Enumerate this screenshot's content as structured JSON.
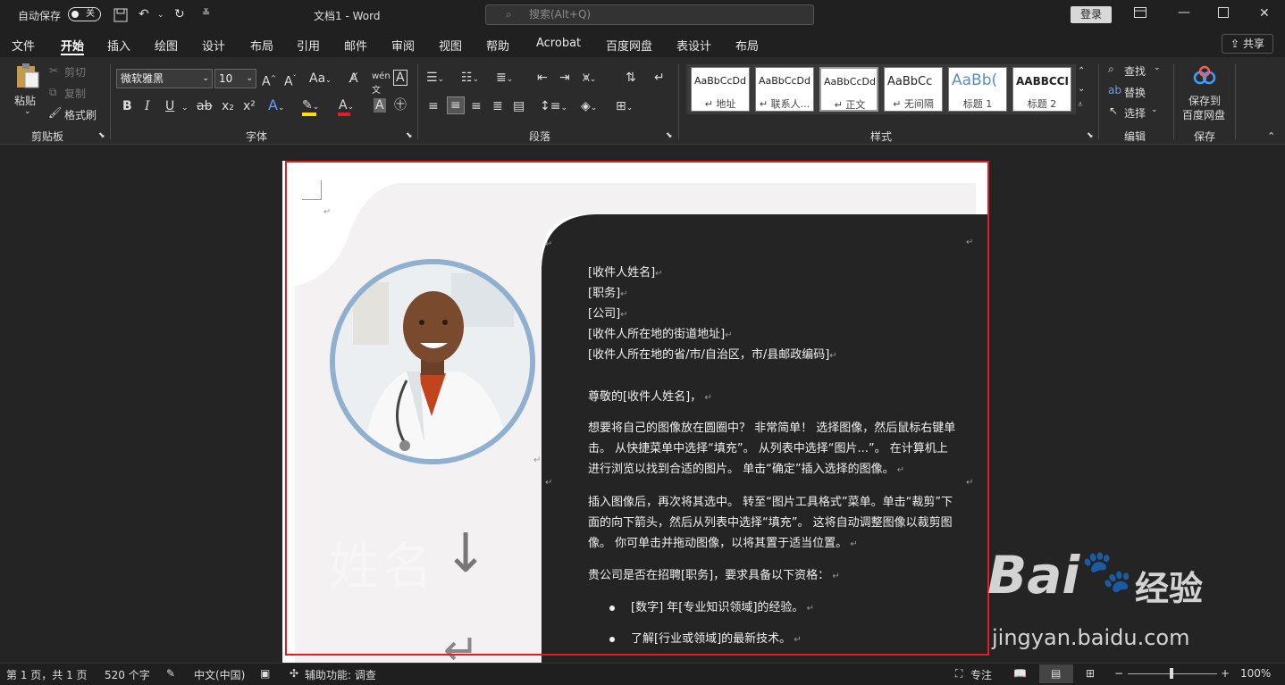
{
  "titlebar": {
    "autosave_label": "自动保存",
    "autosave_state": "关",
    "doc_title": "文档1  -  Word",
    "search_placeholder": "搜索(Alt+Q)",
    "login_label": "登录"
  },
  "menu": {
    "tabs": [
      "文件",
      "开始",
      "插入",
      "绘图",
      "设计",
      "布局",
      "引用",
      "邮件",
      "审阅",
      "视图",
      "帮助",
      "Acrobat",
      "百度网盘",
      "表设计",
      "布局"
    ],
    "active": "开始",
    "share_label": "共享"
  },
  "ribbon": {
    "clipboard": {
      "paste": "粘贴",
      "cut": "剪切",
      "copy": "复制",
      "format_painter": "格式刷",
      "group": "剪贴板"
    },
    "font": {
      "font_name": "微软雅黑",
      "font_size": "10",
      "group": "字体",
      "bold": "B",
      "italic": "I",
      "underline": "U",
      "strike": "ab",
      "sub": "x₂",
      "sup": "x²"
    },
    "paragraph": {
      "group": "段落"
    },
    "styles": {
      "group": "样式",
      "items": [
        {
          "preview": "AaBbCcDd",
          "name": "↵ 地址"
        },
        {
          "preview": "AaBbCcDd",
          "name": "↵ 联系人..."
        },
        {
          "preview": "AaBbCcDd",
          "name": "↵ 正文"
        },
        {
          "preview": "AaBbCc",
          "name": "↵ 无间隔"
        },
        {
          "preview": "AaBb(",
          "name": "标题 1"
        },
        {
          "preview": "AABBCCI",
          "name": "标题 2"
        }
      ]
    },
    "editing": {
      "find": "查找",
      "replace": "替换",
      "select": "选择",
      "group": "编辑"
    },
    "save": {
      "label1": "保存到",
      "label2": "百度网盘",
      "group": "保存"
    }
  },
  "document": {
    "address_lines": [
      "[收件人姓名]",
      "[职务]",
      "[公司]",
      "[收件人所在地的街道地址]",
      "[收件人所在地的省/市/自治区，市/县邮政编码]"
    ],
    "salutation": "尊敬的[收件人姓名]，",
    "para1": "想要将自己的图像放在圆圈中？ 非常简单！ 选择图像，然后鼠标右键单击。 从快捷菜单中选择“填充”。 从列表中选择“图片...”。 在计算机上进行浏览以找到合适的图片。 单击“确定”插入选择的图像。",
    "para2": "插入图像后，再次将其选中。 转至“图片工具格式”菜单。单击“裁剪”下面的向下箭头，然后从列表中选择“填充”。 这将自动调整图像以裁剪图像。 你可单击并拖动图像，以将其置于适当位置。",
    "para3": "贵公司是否在招聘[职务]，要求具备以下资格：",
    "bullets": [
      "[数字] 年[专业知识领域]的经验。",
      "了解[行业或领域]的最新技术。"
    ],
    "faint_name": "姓名"
  },
  "status": {
    "page": "第 1 页，共 1 页",
    "words": "520 个字",
    "lang": "中文(中国)",
    "accessibility": "辅助功能: 调查",
    "focus": "专注",
    "zoom": "100%"
  },
  "watermark": {
    "brand": "Bai",
    "brand2": "经验",
    "url": "jingyan.baidu.com"
  },
  "colors": {
    "accent": "#e02020",
    "title_bg": "#202020",
    "ribbon_bg": "#2b2b2b",
    "photo_ring": "#8fb0cf"
  }
}
